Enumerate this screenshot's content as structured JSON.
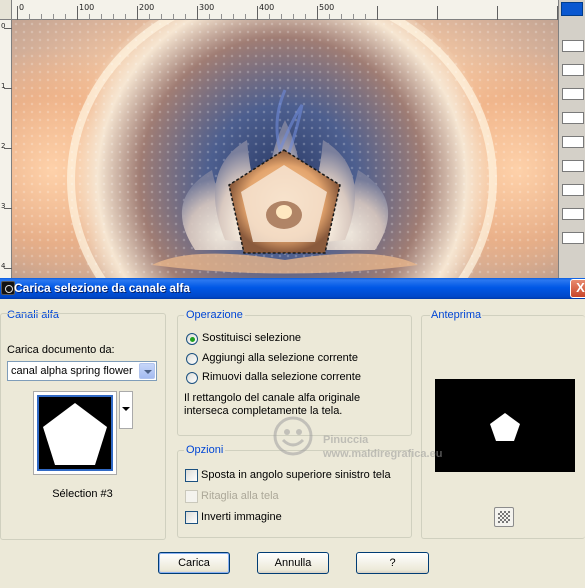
{
  "background_app": {
    "ruler_labels": [
      "0",
      "100",
      "200",
      "300",
      "400",
      "500"
    ],
    "vertical_ruler_labels": [
      "0",
      "1",
      "2",
      "3",
      "4"
    ]
  },
  "dialog": {
    "title": "Carica selezione da canale alfa",
    "close_label": "X",
    "alpha_channels": {
      "section_label": "Canali alfa",
      "load_from_label": "Carica documento da:",
      "document_value": "canal alpha spring flower",
      "selection_caption": "Sélection #3"
    },
    "operation": {
      "group_label": "Operazione",
      "options": [
        {
          "label": "Sostituisci selezione",
          "checked": true
        },
        {
          "label": "Aggiungi alla selezione corrente",
          "checked": false
        },
        {
          "label": "Rimuovi dalla selezione corrente",
          "checked": false
        }
      ],
      "info_text_line1": "Il rettangolo del canale alfa originale",
      "info_text_line2": "interseca completamente la tela."
    },
    "options": {
      "group_label": "Opzioni",
      "items": [
        {
          "label": "Sposta in angolo superiore sinistro tela",
          "checked": false,
          "disabled": false
        },
        {
          "label": "Ritaglia alla tela",
          "checked": false,
          "disabled": true
        },
        {
          "label": "Inverti immagine",
          "checked": false,
          "disabled": false
        }
      ]
    },
    "preview": {
      "section_label": "Anteprima"
    },
    "buttons": {
      "load": "Carica",
      "cancel": "Annulla",
      "help": "?"
    },
    "watermark": {
      "line1": "Pinuccia",
      "line2": "www.maldiregrafica.eu"
    }
  },
  "colors": {
    "titlebar": "#0058e6",
    "group_title": "#0046d5",
    "dialog_bg": "#ece9d8",
    "radio_checked": "#21a121"
  }
}
